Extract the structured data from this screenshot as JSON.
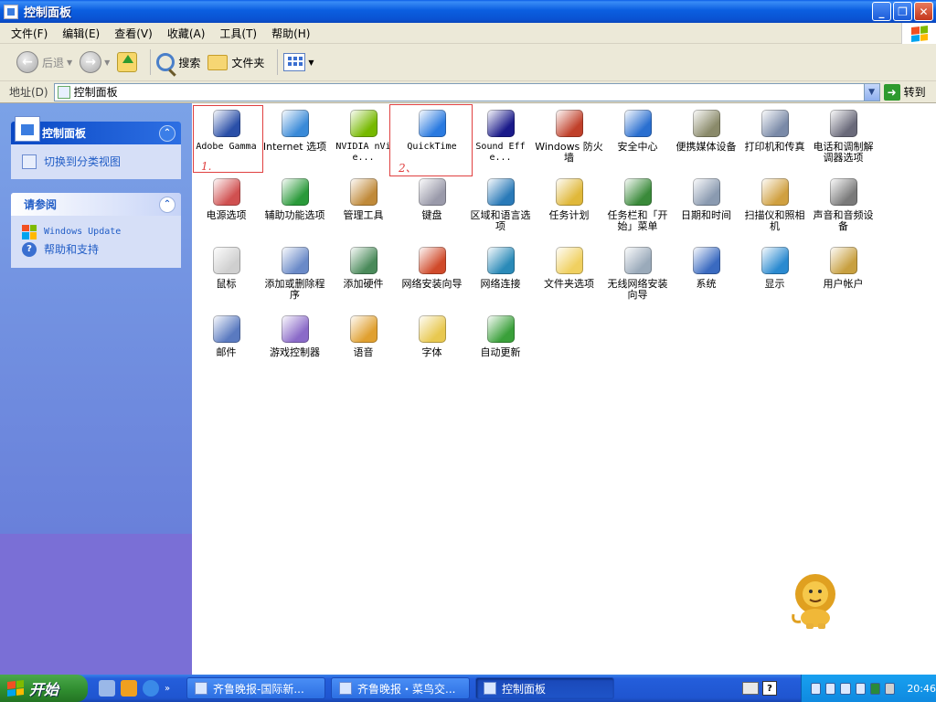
{
  "window": {
    "title": "控制面板",
    "buttons": [
      "_",
      "❐",
      "✕"
    ]
  },
  "menu": [
    "文件(F)",
    "编辑(E)",
    "查看(V)",
    "收藏(A)",
    "工具(T)",
    "帮助(H)"
  ],
  "toolbar": {
    "back": "后退",
    "search": "搜索",
    "folders": "文件夹"
  },
  "address": {
    "label": "地址(D)",
    "value": "控制面板",
    "go": "转到"
  },
  "sidebar": {
    "panel_title": "控制面板",
    "switch_view": "切换到分类视图",
    "see_also_title": "请参阅",
    "see_also": [
      "Windows Update",
      "帮助和支持"
    ]
  },
  "items": [
    {
      "label": "Adobe Gamma",
      "icon": "monitor-icon",
      "mono": true,
      "c": "#2a4fa8"
    },
    {
      "label": "Internet 选项",
      "icon": "globe-icon",
      "c": "#3a8ad8"
    },
    {
      "label": "NVIDIA nVie...",
      "icon": "nvidia-icon",
      "mono": true,
      "c": "#76b900"
    },
    {
      "label": "QuickTime",
      "icon": "quicktime-icon",
      "mono": true,
      "c": "#2a7ae0"
    },
    {
      "label": "Sound Effe...",
      "icon": "sound-icon",
      "mono": true,
      "c": "#1a1a8a"
    },
    {
      "label": "Windows 防火墙",
      "icon": "firewall-icon",
      "c": "#c0402a"
    },
    {
      "label": "安全中心",
      "icon": "shield-icon",
      "c": "#2a6fd0"
    },
    {
      "label": "便携媒体设备",
      "icon": "media-device-icon",
      "c": "#8a8a6a"
    },
    {
      "label": "打印机和传真",
      "icon": "printer-icon",
      "c": "#7a8aa8"
    },
    {
      "label": "电话和调制解调器选项",
      "icon": "phone-icon",
      "c": "#6a6a7a"
    },
    {
      "label": "电源选项",
      "icon": "power-icon",
      "c": "#d05050"
    },
    {
      "label": "辅助功能选项",
      "icon": "accessibility-icon",
      "c": "#2a9a3a"
    },
    {
      "label": "管理工具",
      "icon": "admin-tools-icon",
      "c": "#c08a3a"
    },
    {
      "label": "键盘",
      "icon": "keyboard-icon",
      "c": "#9a9aaa"
    },
    {
      "label": "区域和语言选项",
      "icon": "globe-icon",
      "c": "#2a7ab8"
    },
    {
      "label": "任务计划",
      "icon": "scheduled-tasks-icon",
      "c": "#e0b83a"
    },
    {
      "label": "任务栏和「开始」菜单",
      "icon": "taskbar-icon",
      "c": "#3a8a3a"
    },
    {
      "label": "日期和时间",
      "icon": "calendar-icon",
      "c": "#8a9ab0"
    },
    {
      "label": "扫描仪和照相机",
      "icon": "scanner-icon",
      "c": "#d0a040"
    },
    {
      "label": "声音和音频设备",
      "icon": "speaker-icon",
      "c": "#7a7a7a"
    },
    {
      "label": "鼠标",
      "icon": "mouse-icon",
      "c": "#cfcfcf"
    },
    {
      "label": "添加或删除程序",
      "icon": "add-remove-icon",
      "c": "#6a8ac8"
    },
    {
      "label": "添加硬件",
      "icon": "hardware-icon",
      "c": "#4a8a5a"
    },
    {
      "label": "网络安装向导",
      "icon": "network-setup-icon",
      "c": "#d04a2a"
    },
    {
      "label": "网络连接",
      "icon": "network-icon",
      "c": "#2a8ab8"
    },
    {
      "label": "文件夹选项",
      "icon": "folder-icon",
      "c": "#f0d060"
    },
    {
      "label": "无线网络安装向导",
      "icon": "wireless-icon",
      "c": "#9aaaba"
    },
    {
      "label": "系统",
      "icon": "system-icon",
      "c": "#3a6ac0"
    },
    {
      "label": "显示",
      "icon": "display-icon",
      "c": "#2a8ad0"
    },
    {
      "label": "用户帐户",
      "icon": "user-accounts-icon",
      "c": "#c8a040"
    },
    {
      "label": "邮件",
      "icon": "mail-icon",
      "c": "#5a7ac0"
    },
    {
      "label": "游戏控制器",
      "icon": "gamepad-icon",
      "c": "#8a6ac8"
    },
    {
      "label": "语音",
      "icon": "speech-icon",
      "c": "#e0a030"
    },
    {
      "label": "字体",
      "icon": "fonts-icon",
      "c": "#e8c850"
    },
    {
      "label": "自动更新",
      "icon": "windows-update-icon",
      "c": "#3aa03a"
    }
  ],
  "annotations": [
    "1.",
    "2、"
  ],
  "taskbar": {
    "start": "开始",
    "tasks": [
      "齐鲁晚报-国际新...",
      "齐鲁晚报・菜鸟交...",
      "控制面板"
    ],
    "ime": "?",
    "clock": "20:46"
  },
  "colors": {
    "accent": "#215dc6",
    "flag": [
      "#f25022",
      "#7fba00",
      "#00a4ef",
      "#ffb900"
    ]
  }
}
